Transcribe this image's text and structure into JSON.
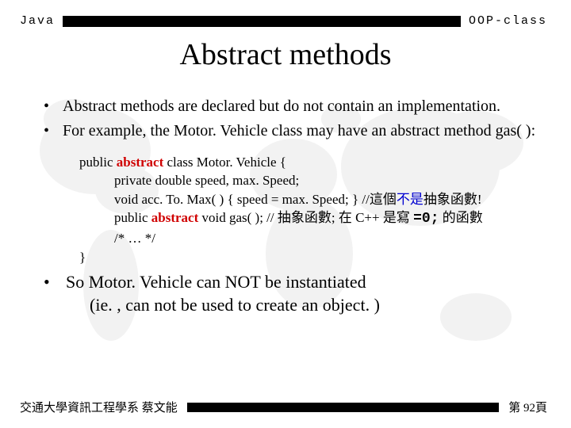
{
  "header": {
    "left": "Java",
    "right": "OOP-class"
  },
  "title": "Abstract methods",
  "bullets_top": [
    "Abstract methods are declared but do not contain an implementation.",
    "For example, the Motor. Vehicle class may have an abstract method gas( ):"
  ],
  "code": {
    "l1a": "public ",
    "l1b": "abstract",
    "l1c": " class Motor. Vehicle {",
    "l2": "private double speed, max. Speed;",
    "l3a": "void acc. To. Max( ) { speed = max. Speed; }  //這個",
    "l3b": "不是",
    "l3c": "抽象函數!",
    "l4a": "public ",
    "l4b": "abstract",
    "l4c": " void gas( );  // 抽象函數; 在 C++ 是寫 ",
    "l4d": "=0;",
    "l4e": " 的函數",
    "l5": "/* … */",
    "l6": "}"
  },
  "bullets_bottom": {
    "line1": "So Motor. Vehicle can NOT be instantiated",
    "line2": "(ie. , can not be used to create an object. )"
  },
  "footer": {
    "left": "交通大學資訊工程學系  蔡文能",
    "right": "第 92頁"
  }
}
